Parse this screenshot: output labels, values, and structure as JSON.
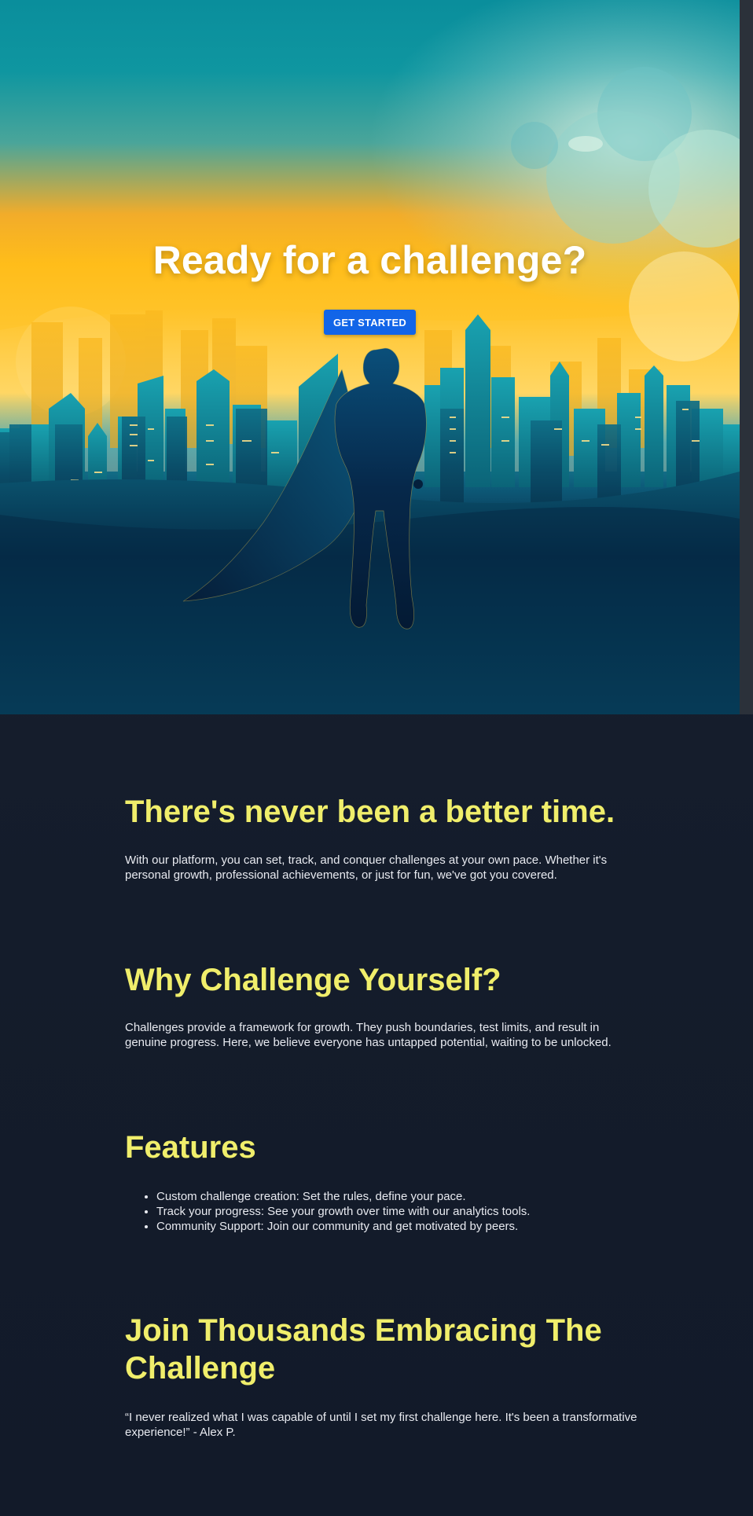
{
  "hero": {
    "title": "Ready for a challenge?",
    "button_label": "GET STARTED"
  },
  "sections": {
    "better_time": {
      "heading": "There's never been a better time.",
      "text": "With our platform, you can set, track, and conquer challenges at your own pace. Whether it's personal growth, professional achievements, or just for fun, we've got you covered."
    },
    "why": {
      "heading": "Why Challenge Yourself?",
      "text": "Challenges provide a framework for growth. They push boundaries, test limits, and result in genuine progress. Here, we believe everyone has untapped potential, waiting to be unlocked."
    },
    "features": {
      "heading": "Features",
      "items": [
        "Custom challenge creation: Set the rules, define your pace.",
        "Track your progress: See your growth over time with our analytics tools.",
        "Community Support: Join our community and get motivated by peers."
      ]
    },
    "join": {
      "heading": "Join Thousands Embracing The Challenge",
      "testimonial": "“I never realized what I was capable of until I set my first challenge here. It's been a transformative experience!” - Alex P."
    }
  },
  "colors": {
    "heading": "#f0ee6b",
    "button": "#1265e8",
    "background": "#151e2c"
  },
  "icons": {
    "hero_illustration": "superhero-city-skyline-illustration"
  }
}
